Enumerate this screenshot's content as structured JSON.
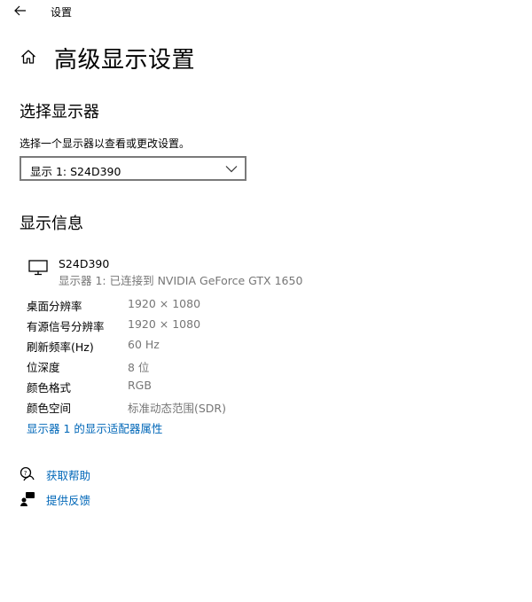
{
  "titlebar": {
    "back_icon": "arrow-left-icon",
    "title": "设置"
  },
  "page": {
    "home_icon": "home-icon",
    "title": "高级显示设置"
  },
  "select_display": {
    "heading": "选择显示器",
    "description": "选择一个显示器以查看或更改设置。",
    "dropdown_value": "显示 1: S24D390"
  },
  "display_info": {
    "heading": "显示信息",
    "monitor_icon": "monitor-icon",
    "device_name": "S24D390",
    "device_connection": "显示器 1: 已连接到 NVIDIA GeForce GTX 1650",
    "rows": [
      {
        "label": "桌面分辨率",
        "value": "1920 × 1080"
      },
      {
        "label": "有源信号分辨率",
        "value": "1920 × 1080"
      },
      {
        "label": "刷新频率(Hz)",
        "value": "60 Hz"
      },
      {
        "label": "位深度",
        "value": "8 位"
      },
      {
        "label": "颜色格式",
        "value": "RGB"
      },
      {
        "label": "颜色空间",
        "value": "标准动态范围(SDR)"
      }
    ],
    "adapter_link": "显示器 1 的显示适配器属性"
  },
  "help": {
    "get_help": "获取帮助",
    "feedback": "提供反馈"
  },
  "colors": {
    "link": "#0067b8",
    "secondary_text": "#767676"
  }
}
